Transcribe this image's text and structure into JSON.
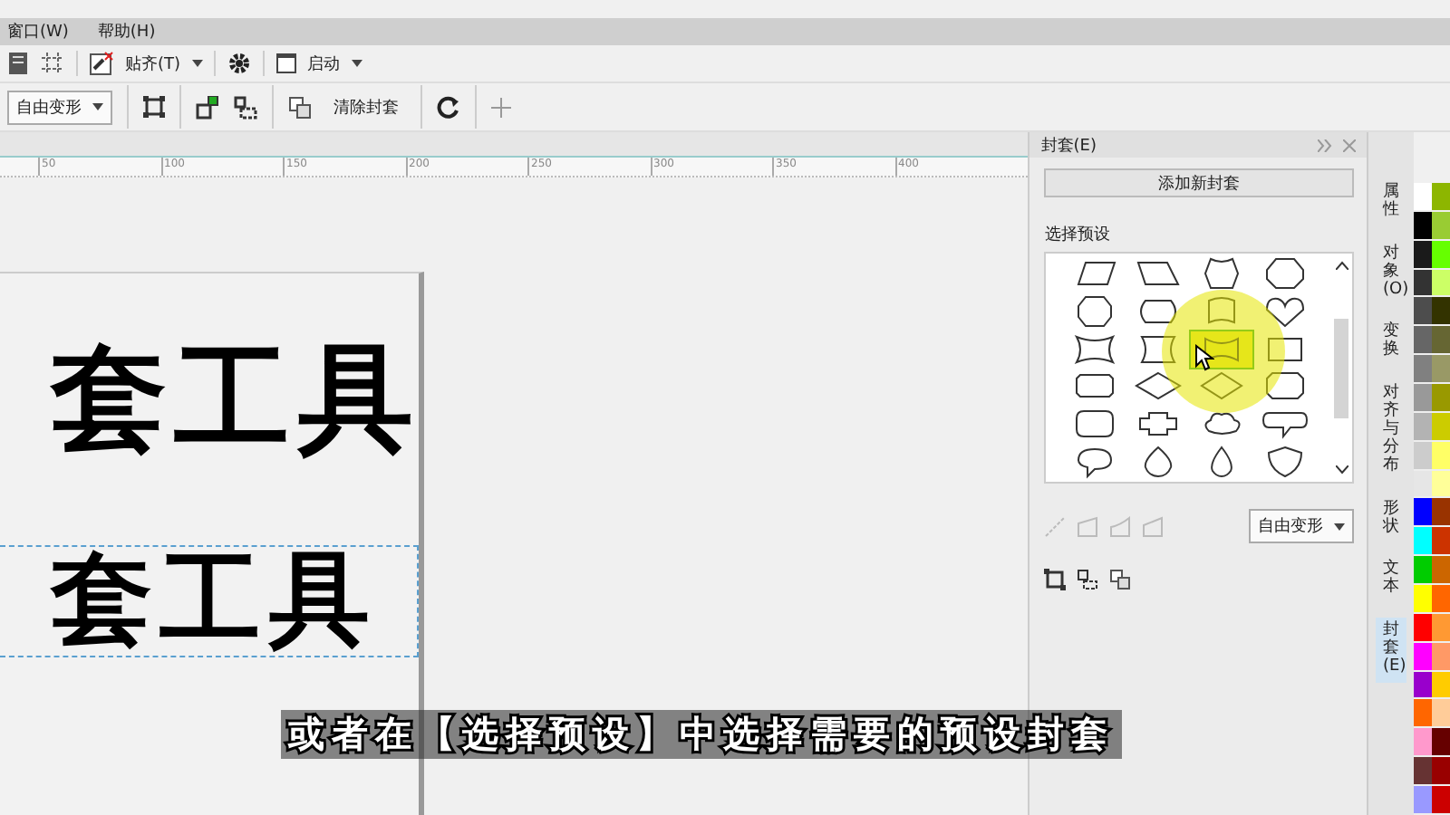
{
  "menu_bar": [
    {
      "label": "窗口(W)"
    },
    {
      "label": "帮助(H)"
    }
  ],
  "toolbar": {
    "snap": "贴齐(T)",
    "launch": "启动"
  },
  "property_bar": {
    "mode": "自由变形",
    "clear_button": "清除封套"
  },
  "ruler": {
    "ticks": [
      "50",
      "100",
      "150",
      "200",
      "250",
      "300",
      "350",
      "400"
    ]
  },
  "canvas": {
    "lines": [
      {
        "text": "套工具",
        "selected": false
      },
      {
        "text": "套工具",
        "selected": true
      }
    ]
  },
  "subtitle": "或者在【选择预设】中选择需要的预设封套",
  "docker": {
    "title": "封套(E)",
    "add_button": "添加新封套",
    "preset_label": "选择预设",
    "mode": "自由变形",
    "presets": [
      {
        "selected": false
      },
      {
        "selected": false
      },
      {
        "selected": false
      },
      {
        "selected": false
      },
      {
        "selected": false
      },
      {
        "selected": false
      },
      {
        "selected": false
      },
      {
        "selected": false
      },
      {
        "selected": false
      },
      {
        "selected": false
      },
      {
        "selected": true
      },
      {
        "selected": false
      },
      {
        "selected": false
      },
      {
        "selected": false
      },
      {
        "selected": false
      },
      {
        "selected": false
      },
      {
        "selected": false
      },
      {
        "selected": false
      },
      {
        "selected": false
      },
      {
        "selected": false
      },
      {
        "selected": false
      },
      {
        "selected": false
      },
      {
        "selected": false
      },
      {
        "selected": false
      }
    ]
  },
  "side_tabs": [
    {
      "label": "属性",
      "selected": false
    },
    {
      "label": "对象(O)",
      "selected": false
    },
    {
      "label": "变换",
      "selected": false
    },
    {
      "label": "对齐与分布",
      "selected": false
    },
    {
      "label": "形状",
      "selected": false
    },
    {
      "label": "文本",
      "selected": false
    },
    {
      "label": "封套(E)",
      "selected": true
    }
  ],
  "palette": {
    "columns": [
      [
        {
          "color": "#ffffff"
        },
        {
          "color": "#000000"
        },
        {
          "color": "#1a1a1a"
        },
        {
          "color": "#333333"
        },
        {
          "color": "#4d4d4d"
        },
        {
          "color": "#666666"
        },
        {
          "color": "#808080"
        },
        {
          "color": "#999999"
        },
        {
          "color": "#b3b3b3"
        },
        {
          "color": "#cccccc"
        },
        {
          "color": "#e6e6e6"
        },
        {
          "color": "#0000ff"
        },
        {
          "color": "#00ffff"
        },
        {
          "color": "#00cc00"
        },
        {
          "color": "#ffff00"
        },
        {
          "color": "#ff0000"
        },
        {
          "color": "#ff00ff"
        },
        {
          "color": "#9900cc"
        },
        {
          "color": "#ff6600"
        },
        {
          "color": "#ff99cc"
        },
        {
          "color": "#663333"
        },
        {
          "color": "#9999ff"
        }
      ],
      [
        {
          "color": "#8db600"
        },
        {
          "color": "#99cc33"
        },
        {
          "color": "#66ff00"
        },
        {
          "color": "#ccff66"
        },
        {
          "color": "#333300"
        },
        {
          "color": "#666633"
        },
        {
          "color": "#999966"
        },
        {
          "color": "#999900"
        },
        {
          "color": "#cccc00"
        },
        {
          "color": "#ffff66"
        },
        {
          "color": "#ffff99"
        },
        {
          "color": "#993300"
        },
        {
          "color": "#cc3300"
        },
        {
          "color": "#cc6600"
        },
        {
          "color": "#ff6600"
        },
        {
          "color": "#ff9933"
        },
        {
          "color": "#ff9966"
        },
        {
          "color": "#ffcc00"
        },
        {
          "color": "#ffcc99"
        },
        {
          "color": "#660000"
        },
        {
          "color": "#990000"
        },
        {
          "color": "#cc0000"
        }
      ]
    ]
  }
}
